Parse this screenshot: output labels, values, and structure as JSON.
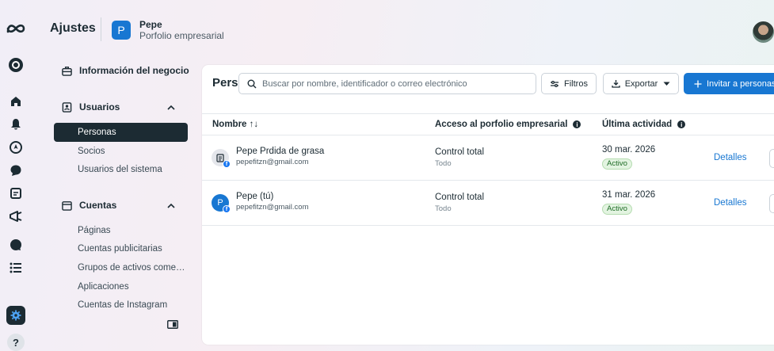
{
  "header": {
    "title": "Ajustes",
    "portfolio_initial": "P",
    "portfolio_name": "Pepe",
    "portfolio_type": "Porfolio empresarial"
  },
  "sidebar": {
    "business_info": "Información del negocio",
    "users_section": "Usuarios",
    "users_items": [
      "Personas",
      "Socios",
      "Usuarios del sistema"
    ],
    "accounts_section": "Cuentas",
    "accounts_items": [
      "Páginas",
      "Cuentas publicitarias",
      "Grupos de activos come…",
      "Aplicaciones",
      "Cuentas de Instagram"
    ]
  },
  "main": {
    "title": "Personas",
    "search_placeholder": "Buscar por nombre, identificador o correo electrónico",
    "filters_label": "Filtros",
    "export_label": "Exportar",
    "invite_label": "Invitar a personas",
    "columns": {
      "name": "Nombre ↑↓",
      "access": "Acceso al porfolio empresarial",
      "activity": "Última actividad"
    },
    "rows": [
      {
        "name": "Pepe Prdida de grasa",
        "email": "pepefitzn@gmail.com",
        "access": "Control total",
        "access_sub": "Todo",
        "date": "30 mar. 2026",
        "status": "Activo",
        "action": "Detalles",
        "icon": "page-icon"
      },
      {
        "name": "Pepe (tú)",
        "email": "pepefitzn@gmail.com",
        "access": "Control total",
        "access_sub": "Todo",
        "date": "31 mar. 2026",
        "status": "Activo",
        "action": "Detalles",
        "icon": "P"
      }
    ]
  },
  "rail": {
    "help": "?"
  },
  "colors": {
    "accent": "#1877d2",
    "dark": "#1c2b33",
    "active_green": "#1e6b25"
  }
}
